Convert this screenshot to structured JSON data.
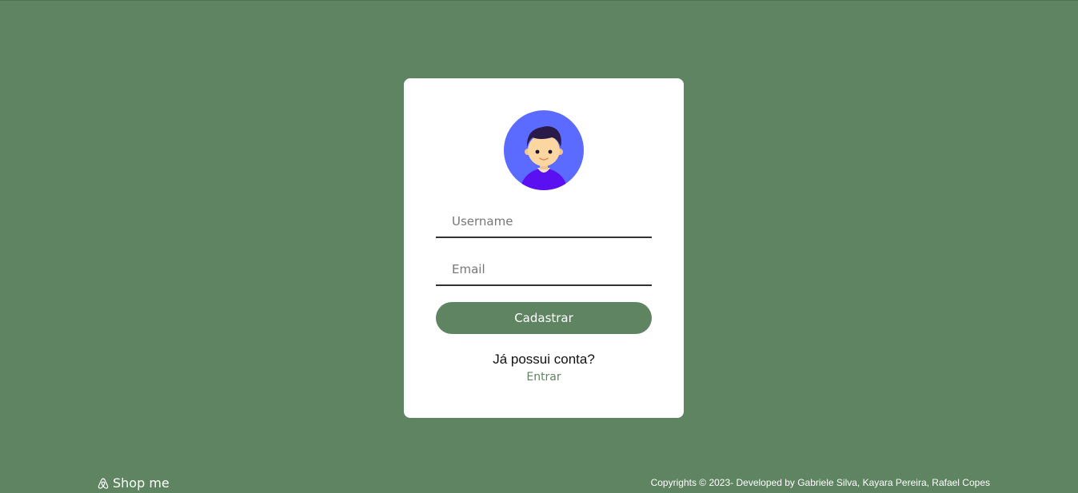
{
  "form": {
    "username_placeholder": "Username",
    "email_placeholder": "Email",
    "submit_label": "Cadastrar",
    "question": "Já possui conta?",
    "login_link": "Entrar"
  },
  "footer": {
    "brand": "Shop me",
    "brand_icon": "airbnb-logo-icon",
    "copyright": "Copyrights © 2023- Developed by Gabriele Silva, Kayara Pereira, Rafael Copes"
  },
  "colors": {
    "background": "#5f8461",
    "card": "#ffffff",
    "accent": "#5f8461",
    "avatar_bg": "#5c6bff"
  }
}
